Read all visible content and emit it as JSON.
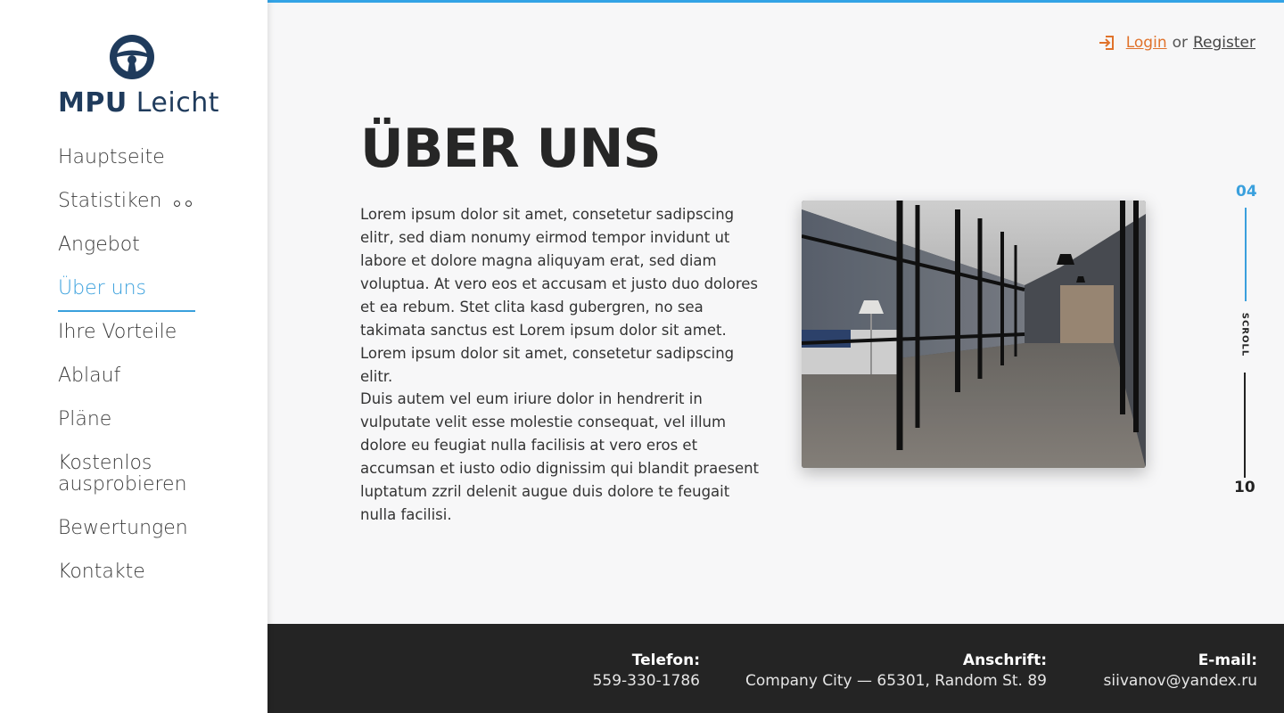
{
  "brand": {
    "name_bold": "MPU",
    "name_regular": "Leicht",
    "logo_icon": "steering-wheel-icon"
  },
  "nav": {
    "items": [
      {
        "label": "Hauptseite"
      },
      {
        "label": "Statistiken"
      },
      {
        "label": "Angebot"
      },
      {
        "label": "Über uns"
      },
      {
        "label": "Ihre Vorteile"
      },
      {
        "label": "Ablauf"
      },
      {
        "label": "Pläne"
      },
      {
        "label": "Kostenlos ausprobieren"
      },
      {
        "label": "Bewertungen"
      },
      {
        "label": "Kontakte"
      }
    ],
    "active_index": 3
  },
  "auth": {
    "login_label": "Login",
    "separator": "or",
    "register_label": "Register"
  },
  "main": {
    "title": "ÜBER UNS",
    "paragraph1": "Lorem ipsum dolor sit amet, consetetur sadipscing elitr, sed diam nonumy eirmod tempor invidunt ut labore et dolore magna aliquyam erat, sed diam voluptua. At vero eos et accusam et justo duo dolores et ea rebum. Stet clita kasd gubergren, no sea takimata sanctus est Lorem ipsum dolor sit amet. Lorem ipsum dolor sit amet, consetetur sadipscing elitr.",
    "paragraph2": "Duis autem vel eum iriure dolor in hendrerit in vulputate velit esse molestie consequat, vel illum dolore eu feugiat nulla facilisis at vero eros et accumsan et iusto odio dignissim qui blandit praesent luptatum zzril delenit augue duis dolore te feugait nulla facilisi."
  },
  "scroll": {
    "current": "04",
    "label": "SCROLL",
    "total": "10"
  },
  "footer": {
    "phone_label": "Telefon:",
    "phone_value": "559-330-1786",
    "address_label": "Anschrift:",
    "address_value": "Company City — 65301, Random St. 89",
    "email_label": "E-mail:",
    "email_value": "siivanov@yandex.ru"
  },
  "colors": {
    "accent_blue": "#3aa0dd",
    "login_orange": "#e0722b",
    "brand_navy": "#1f3b5c",
    "footer_bg": "#242424"
  }
}
